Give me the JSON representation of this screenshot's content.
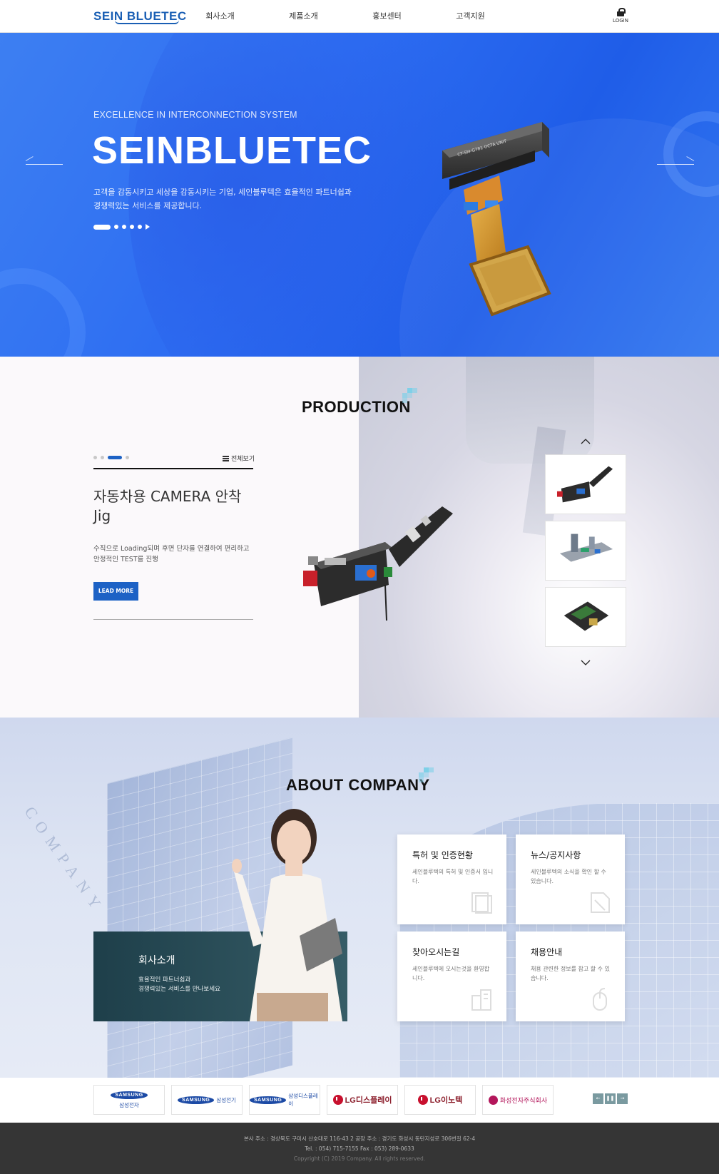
{
  "header": {
    "logo": "SEIN BLUETEC",
    "nav": [
      "회사소개",
      "제품소개",
      "홍보센터",
      "고객지원"
    ],
    "login_label": "LOGIN"
  },
  "hero": {
    "kicker": "EXCELLENCE IN INTERCONNECTION SYSTEM",
    "title": "SEINBLUETEC",
    "desc_line1": "고객을 감동시키고 세상을 감동시키는 기업, 세인블루텍은 효율적인 파트너쉽과",
    "desc_line2": "경쟁력있는 서비스를 제공합니다.",
    "product_label": "CT-SM-G781 OCTA UNIT",
    "slide_count": 6,
    "active_slide": 1
  },
  "production": {
    "section_title": "PRODUCTION",
    "view_all": "전체보기",
    "title": "자동차용 CAMERA 안착 Jig",
    "desc": "수직으로 Loading되며 후면 단자를 연결하여 편리하고 안정적인 TEST를 진행",
    "button": "LEAD MORE",
    "slide_count": 4,
    "active_slide": 3,
    "thumbnails": [
      "camera-jig-thumbnail",
      "test-fixture-thumbnail",
      "pcb-socket-thumbnail"
    ]
  },
  "about": {
    "section_title": "ABOUT COMPANY",
    "arc_text": "COMPANY",
    "company_card": {
      "title": "회사소개",
      "desc_line1": "효율적인 파트너쉽과",
      "desc_line2": "경쟁력있는 서비스를 만나보세요"
    },
    "tiles": [
      {
        "title": "특허 및 인증현황",
        "desc": "세인블루텍의 특허 및 인증서 입니다.",
        "icon": "document-icon"
      },
      {
        "title": "뉴스/공지사항",
        "desc": "세인블루텍의 소식을 확인 할 수 있습니다.",
        "icon": "news-icon"
      },
      {
        "title": "찾아오시는길",
        "desc": "세인블루텍에 오시는것을 환영합니다.",
        "icon": "building-icon"
      },
      {
        "title": "채용안내",
        "desc": "채용 관련한 정보를 참고 할 수 있습니다.",
        "icon": "mouse-icon"
      }
    ]
  },
  "partners": {
    "items": [
      {
        "mark": "SAMSUNG",
        "name": "삼성전자"
      },
      {
        "mark": "SAMSUNG",
        "name": "삼성전기"
      },
      {
        "mark": "SAMSUNG",
        "name": "삼성디스플레이"
      },
      {
        "mark": "LG",
        "name": "LG디스플레이"
      },
      {
        "mark": "LG",
        "name": "LG이노텍"
      },
      {
        "mark": "HS",
        "name": "화성전자주식회사"
      }
    ],
    "controls": [
      "prev",
      "pause",
      "next"
    ]
  },
  "footer": {
    "address": "본사 주소 : 경상북도 구미시 산호대로 116-43      2 공장 주소 : 경기도 화성시 동탄지성로 306번길 62-4",
    "contact": "Tel. : 054) 715-7155      Fax : 053) 289-0633",
    "copyright": "Copyright (C) 2019 Company. All rights reserved."
  },
  "colors": {
    "brand": "#1a5fb4",
    "hero_bg": "#2d6df2",
    "button": "#1d62c5",
    "accent_pixel": "#7fd0e8",
    "company_card": "#2a4c57",
    "footer_bg": "#353535"
  }
}
